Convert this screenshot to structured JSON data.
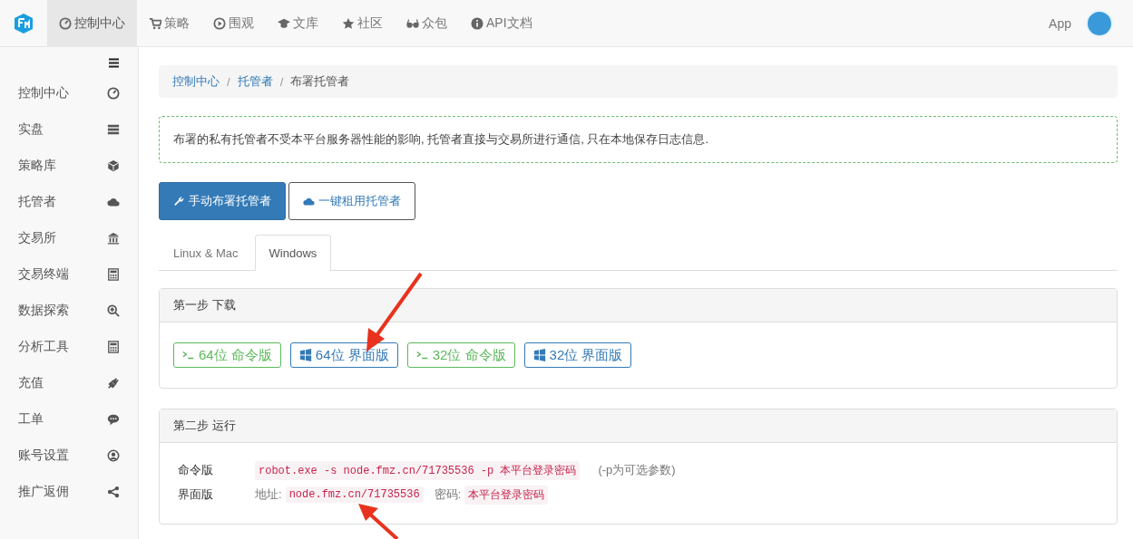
{
  "topnav": {
    "items": [
      {
        "label": "控制中心",
        "selected": true
      },
      {
        "label": "策略",
        "selected": false
      },
      {
        "label": "围观",
        "selected": false
      },
      {
        "label": "文库",
        "selected": false
      },
      {
        "label": "社区",
        "selected": false
      },
      {
        "label": "众包",
        "selected": false
      },
      {
        "label": "API文档",
        "selected": false
      }
    ],
    "app": "App"
  },
  "sidebar": {
    "items": [
      {
        "label": "控制中心"
      },
      {
        "label": "实盘"
      },
      {
        "label": "策略库"
      },
      {
        "label": "托管者"
      },
      {
        "label": "交易所"
      },
      {
        "label": "交易终端"
      },
      {
        "label": "数据探索"
      },
      {
        "label": "分析工具"
      },
      {
        "label": "充值"
      },
      {
        "label": "工单"
      },
      {
        "label": "账号设置"
      },
      {
        "label": "推广返佣"
      }
    ]
  },
  "breadcrumb": [
    {
      "kind": "link",
      "label": "控制中心"
    },
    {
      "kind": "separator",
      "label": "/"
    },
    {
      "kind": "link",
      "label": "托管者"
    },
    {
      "kind": "separator",
      "label": "/"
    },
    {
      "kind": "current",
      "label": "布署托管者"
    }
  ],
  "notice": "布署的私有托管者不受本平台服务器性能的影响, 托管者直接与交易所进行通信, 只在本地保存日志信息.",
  "actions": [
    {
      "label": "手动布署托管者",
      "selected": true
    },
    {
      "label": "一键租用托管者",
      "selected": false
    }
  ],
  "os_tabs": [
    {
      "label": "Linux & Mac",
      "selected": false
    },
    {
      "label": "Windows",
      "selected": true
    }
  ],
  "step1": {
    "title": "第一步 下载",
    "downloads": [
      {
        "label": "64位 命令版",
        "kind": "console"
      },
      {
        "label": "64位 界面版",
        "kind": "gui"
      },
      {
        "label": "32位 命令版",
        "kind": "console"
      },
      {
        "label": "32位 界面版",
        "kind": "gui"
      }
    ]
  },
  "step2": {
    "title": "第二步 运行",
    "rows": [
      {
        "label": "命令版",
        "parts": [
          {
            "kind": "code",
            "text": "robot.exe -s node.fmz.cn/71735536 -p 本平台登录密码"
          },
          {
            "kind": "note",
            "text": "(-p为可选参数)"
          }
        ]
      },
      {
        "label": "界面版",
        "parts": [
          {
            "kind": "text",
            "text": "地址:"
          },
          {
            "kind": "code",
            "text": "node.fmz.cn/71735536"
          },
          {
            "kind": "text",
            "text": "密码:"
          },
          {
            "kind": "code",
            "text": "本平台登录密码"
          }
        ]
      }
    ]
  }
}
